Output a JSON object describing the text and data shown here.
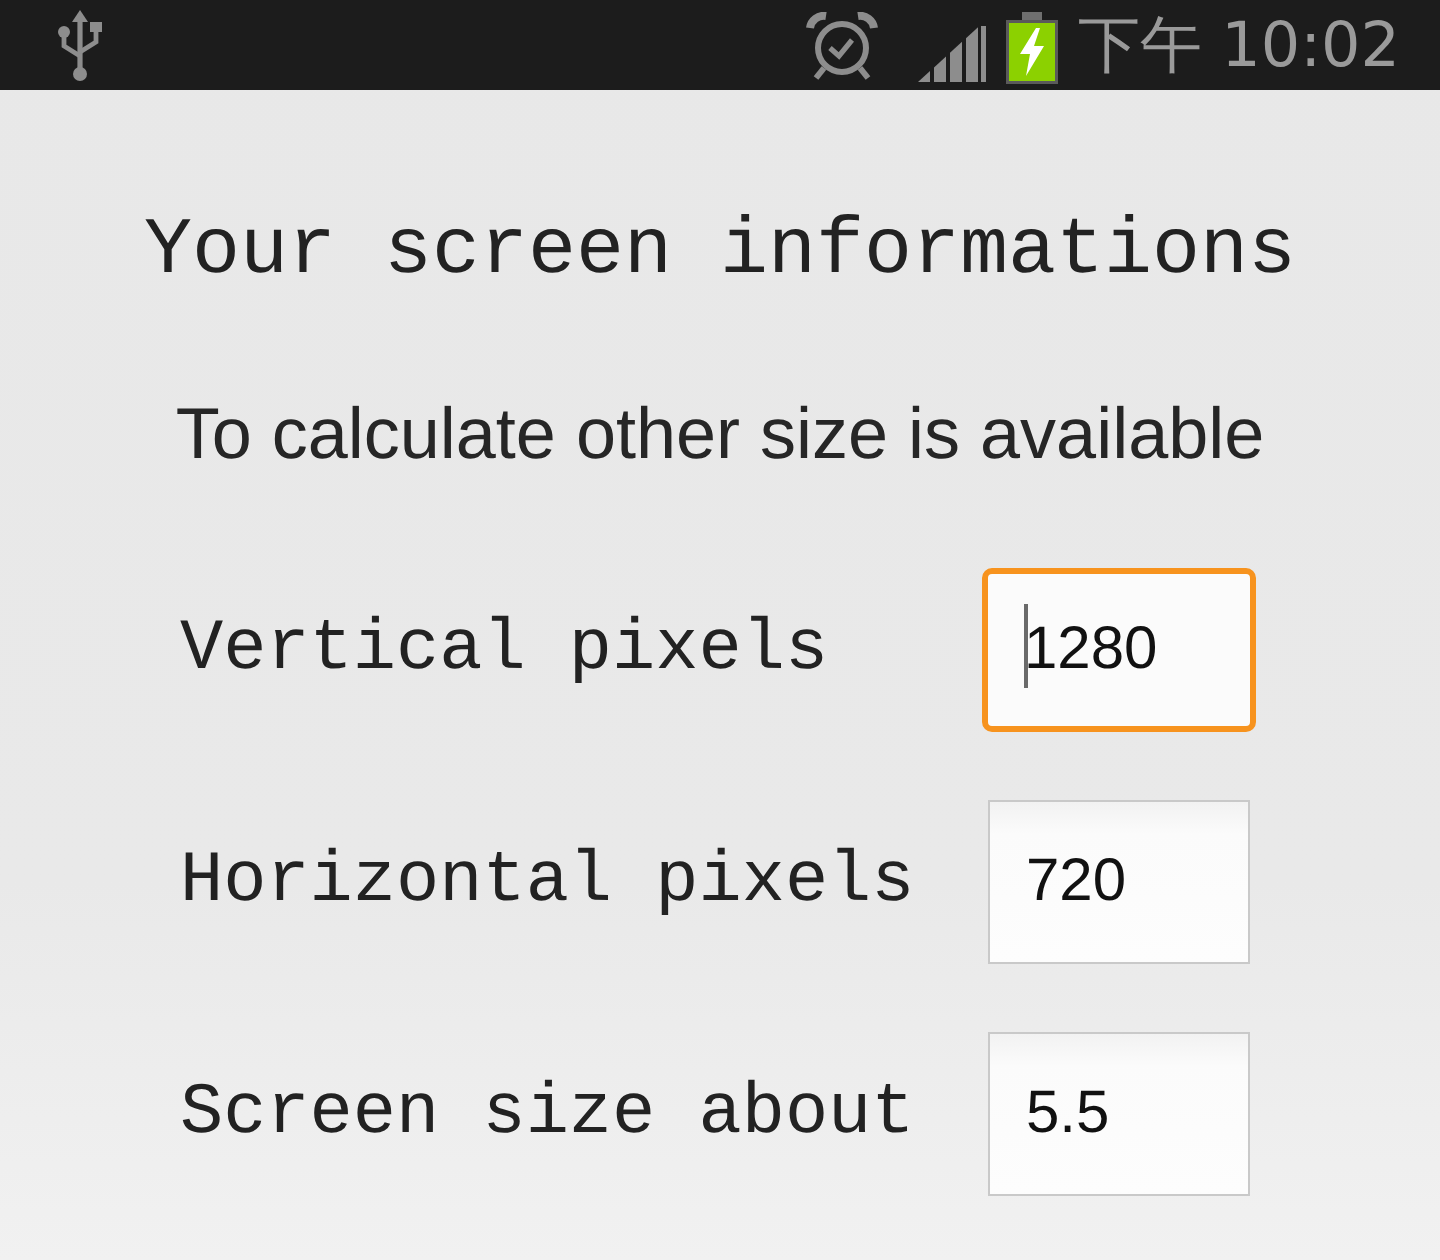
{
  "status_bar": {
    "time": "下午 10:02",
    "battery": {
      "charging": true
    }
  },
  "title": "Your screen informations",
  "subtitle": "To calculate other size is available",
  "fields": [
    {
      "label": "Vertical pixels",
      "value": "1280",
      "focused": true
    },
    {
      "label": "Horizontal pixels",
      "value": "720",
      "focused": false
    },
    {
      "label": "Screen size about",
      "value": "5.5",
      "focused": false
    }
  ]
}
